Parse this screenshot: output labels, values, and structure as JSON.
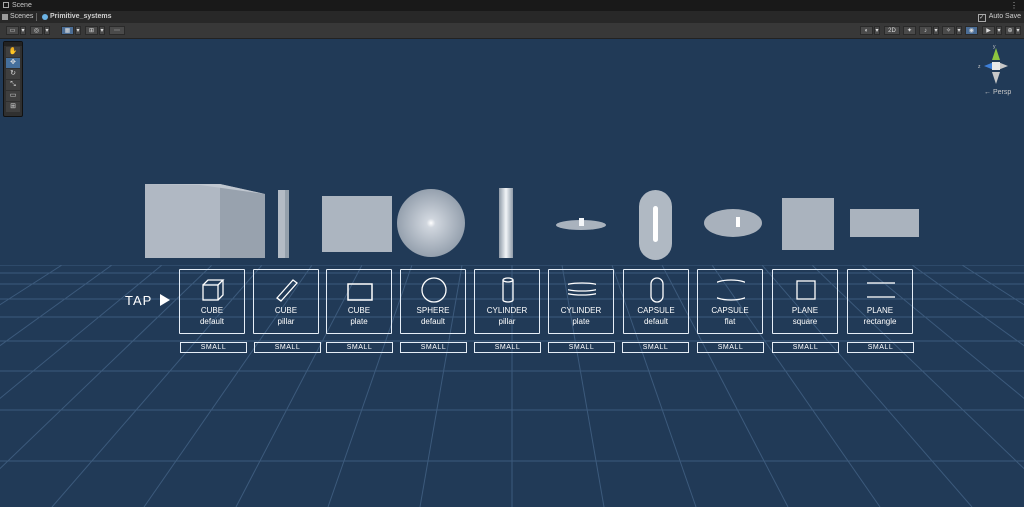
{
  "window": {
    "tab_title": "Scene"
  },
  "breadcrumbs": {
    "root": "Scenes",
    "current": "Primitive_systems",
    "auto_save": "Auto Save"
  },
  "toolbar": {
    "view_2d": "2D"
  },
  "gizmo": {
    "axis_y": "y",
    "axis_z": "z",
    "projection": "← Persp"
  },
  "scene": {
    "tap_label": "TAP",
    "small_label": "SMALL",
    "cards": [
      {
        "line1": "CUBE",
        "line2": "default",
        "icon": "cube-icon"
      },
      {
        "line1": "CUBE",
        "line2": "pillar",
        "icon": "cube-pillar-icon"
      },
      {
        "line1": "CUBE",
        "line2": "plate",
        "icon": "cube-plate-icon"
      },
      {
        "line1": "SPHERE",
        "line2": "default",
        "icon": "sphere-icon"
      },
      {
        "line1": "CYLINDER",
        "line2": "pillar",
        "icon": "cylinder-pillar-icon"
      },
      {
        "line1": "CYLINDER",
        "line2": "plate",
        "icon": "cylinder-plate-icon"
      },
      {
        "line1": "CAPSULE",
        "line2": "default",
        "icon": "capsule-icon"
      },
      {
        "line1": "CAPSULE",
        "line2": "flat",
        "icon": "capsule-flat-icon"
      },
      {
        "line1": "PLANE",
        "line2": "square",
        "icon": "plane-square-icon"
      },
      {
        "line1": "PLANE",
        "line2": "rectangle",
        "icon": "plane-rectangle-icon"
      }
    ]
  },
  "colors": {
    "background": "#213a57",
    "grid": "#3c5a7c",
    "primitive": "#b4bcc6",
    "ui_line": "#e6eef7"
  }
}
